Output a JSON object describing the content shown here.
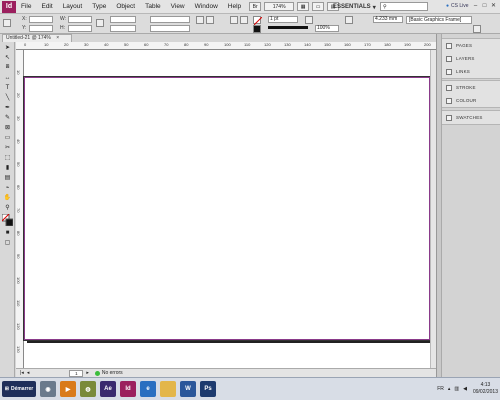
{
  "app": {
    "logo": "Id",
    "menu": [
      "File",
      "Edit",
      "Layout",
      "Type",
      "Object",
      "Table",
      "View",
      "Window",
      "Help"
    ],
    "zoom": "174%",
    "workspace": "ESSENTIALS",
    "search_placeholder": "",
    "cs_live": "CS Live"
  },
  "control_bar": {
    "x_label": "X:",
    "y_label": "Y:",
    "w_label": "W:",
    "h_label": "H:",
    "stroke_weight": "1 pt",
    "opacity": "100%",
    "fit_value": "4.233 mm",
    "object_style": "[Basic Graphics Frame]"
  },
  "document": {
    "tab_title": "Untitled-21 @ 174%",
    "ruler_top": [
      "0",
      "10",
      "20",
      "30",
      "40",
      "50",
      "60",
      "70",
      "80",
      "90",
      "100",
      "110",
      "120",
      "130",
      "140",
      "150",
      "160",
      "170",
      "180",
      "190",
      "200"
    ],
    "ruler_left": [
      "10",
      "20",
      "30",
      "40",
      "50",
      "60",
      "70",
      "80",
      "90",
      "100",
      "110",
      "120",
      "130"
    ],
    "status_page": "1",
    "status_errors": "No errors"
  },
  "panels": {
    "group1": [
      "PAGES",
      "LAYERS",
      "LINKS"
    ],
    "group2": [
      "STROKE",
      "COLOUR"
    ],
    "group3": [
      "SWATCHES"
    ]
  },
  "taskbar": {
    "start_label": "Démarrer",
    "apps": [
      {
        "name": "ae-icon",
        "label": "Ae",
        "color": "#3a2a6e"
      },
      {
        "name": "indesign-icon",
        "label": "Id",
        "color": "#9b1f5e"
      },
      {
        "name": "ie-icon",
        "label": "e",
        "color": "#2a6fc0"
      },
      {
        "name": "folder-icon",
        "label": "",
        "color": "#e3b64a"
      },
      {
        "name": "word-icon",
        "label": "W",
        "color": "#2b579a"
      },
      {
        "name": "photoshop-icon",
        "label": "Ps",
        "color": "#1d3a6e"
      }
    ],
    "lang": "FR",
    "time": "4:13",
    "date": "09/02/2013"
  }
}
